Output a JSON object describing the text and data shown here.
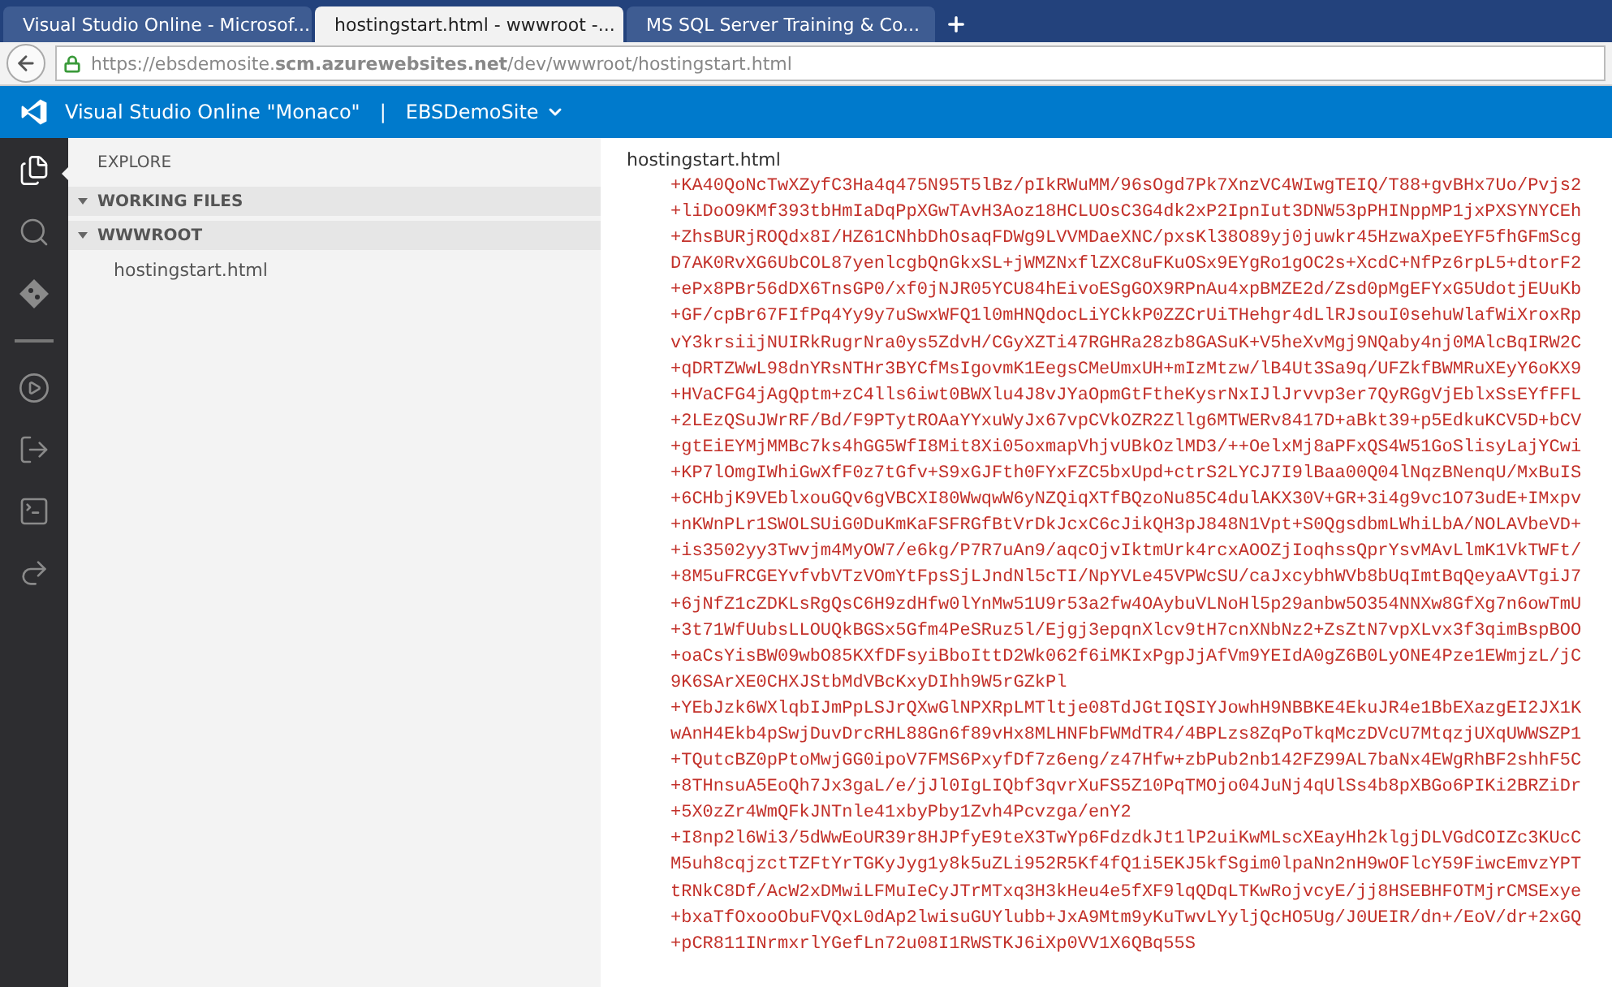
{
  "browser_tabs": [
    {
      "title": "Visual Studio Online - Microsof...",
      "selected": false
    },
    {
      "title": "hostingstart.html - wwwroot -...",
      "selected": true
    },
    {
      "title": "MS SQL Server Training & Co...",
      "selected": false
    }
  ],
  "address_bar": {
    "url": "https://ebsdemosite.**scm.azurewebsites.net**/dev/wwwroot/hostingstart.html"
  },
  "app_header": {
    "title": "Visual Studio Online \"Monaco\"",
    "separator": "|",
    "site": "EBSDemoSite"
  },
  "activity_bar": [
    {
      "selected": true
    },
    {
      "selected": false
    },
    {
      "selected": false
    },
    {
      "selected": false
    },
    {
      "selected": false
    },
    {
      "selected": false
    },
    {
      "selected": false
    }
  ],
  "sidebar": {
    "title": "EXPLORE",
    "sections": [
      {
        "label": "WORKING FILES",
        "expanded": true
      },
      {
        "label": "WWWROOT",
        "expanded": true,
        "children": [
          {
            "label": "hostingstart.html"
          }
        ]
      }
    ]
  },
  "editor": {
    "file_name": "hostingstart.html",
    "lines": [
      "+KA40QoNcTwXZyfC3Ha4q475N95T5lBz/pIkRWuMM/96sOgd7Pk7XnzVC4WIwgTEIQ/T88+gvBHx7Uo/Pvjs2",
      "+liDoO9KMf393tbHmIaDqPpXGwTAvH3Aoz18HCLUOsC3G4dk2xP2IpnIut3DNW53pPHINppMP1jxPXSYNYCEh",
      "+ZhsBURjROQdx8I/HZ61CNhbDhOsaqFDWg9LVVMDaeXNC/pxsKl38O89yj0juwkr45HzwaXpeEYF5fhGFmScg",
      "D7AK0RvXG6UbCOL87yenlcgbQnGkxSL+jWMZNxflZXC8uFKuOSx9EYgRo1gOC2s+XcdC+NfPz6rpL5+dtorF2",
      "+ePx8PBr56dDX6TnsGP0/xf0jNJR05YCU84hEivoESgGOX9RPnAu4xpBMZE2d/Zsd0pMgEFYxG5UdotjEUuKb",
      "+GF/cpBr67FIfPq4Yy9y7uSwxWFQ1l0mHNQdocLiYCkkP0ZZCrUiTHehgr4dLlRJsouI0sehuWlafWiXroxRp",
      "vY3krsiijNUIRkRugrNra0ys5ZdvH/CGyXZTi47RGHRa28zb8GASuK+V5heXvMgj9NQaby4nj0MAlcBqIRW2C",
      "+qDRTZWwL98dnYRsNTHr3BYCfMsIgovmK1EegsCMeUmxUH+mIzMtzw/lB4Ut3Sa9q/UFZkfBWMRuXEyY6oKX9",
      "+HVaCFG4jAgQptm+zC4lls6iwt0BWXlu4J8vJYaOpmGtFtheKysrNxIJlJrvvp3er7QyRGgVjEblxSsEYfFFL",
      "+2LEzQSuJWrRF/Bd/F9PTytROAaYYxuWyJx67vpCVkOZR2Zllg6MTWERv8417D+aBkt39+p5EdkuKCV5D+bCV",
      "+gtEiEYMjMMBc7ks4hGG5WfI8Mit8Xi05oxmapVhjvUBkOzlMD3/++OelxMj8aPFxQS4W51GoSlisyLajYCwi",
      "+KP7lOmgIWhiGwXfF0z7tGfv+S9xGJFth0FYxFZC5bxUpd+ctrS2LYCJ7I9lBaa00Q04lNqzBNenqU/MxBuIS",
      "+6CHbjK9VEblxouGQv6gVBCXI80WwqwW6yNZQiqXTfBQzoNu85C4dulAKX30V+GR+3i4g9vc1O73udE+IMxpv",
      "+nKWnPLr1SWOLSUiG0DuKmKaFSFRGfBtVrDkJcxC6cJikQH3pJ848N1Vpt+S0QgsdbmLWhiLbA/NOLAVbeVD+",
      "+is3502yy3Twvjm4MyOW7/e6kg/P7R7uAn9/aqcOjvIktmUrk4rcxAOOZjIoqhssQprYsvMAvLlmK1VkTWFt/",
      "+8M5uFRCGEYvfvbVTzVOmYtFpsSjLJndNl5cTI/NpYVLe45VPWcSU/caJxcybhWVb8bUqImtBqQeyaAVTgiJ7",
      "+6jNfZ1cZDKLsRgQsC6H9zdHfw0lYnMw51U9r53a2fw4OAybuVLNoHl5p29anbw5O354NNXw8GfXg7n6owTmU",
      "+3t71WfUubsLLOUQkBGSx5Gfm4PeSRuz5l/Ejgj3epqnXlcv9tH7cnXNbNz2+ZsZtN7vpXLvx3f3qimBspBOO",
      "+oaCsYisBW09wbO85KXfDFsyiBboIttD2Wk062f6iMKIxPgpJjAfVm9YEIdA0gZ6B0LyONE4Pze1EWmjzL/jC",
      "9K6SArXE0CHXJStbMdVBcKxyDIhh9W5rGZkPl",
      "+YEbJzk6WXlqbIJmPpLSJrQXwGlNPXRpLMTltje08TdJGtIQSIYJowhH9NBBKE4EkuJR4e1BbEXazgEI2JX1K",
      "wAnH4Ekb4pSwjDuvDrcRHL88Gn6f89vHx8MLHNFbFWMdTR4/4BPLzs8ZqPoTkqMczDVcU7MtqzjUXqUWWSZP1",
      "+TQutcBZ0pPtoMwjGG0ipoV7FMS6PxyfDf7z6eng/z47Hfw+zbPub2nb142FZ99AL7baNx4EWgRhBF2shhF5C",
      "+8THnsuA5EoQh7Jx3gaL/e/jJl0IgLIQbf3qvrXuFS5Z10PqTMOjo04JuNj4qUlSs4b8pXBGo6PIKi2BRZiDr",
      "+5X0zZr4WmQFkJNTnle41xbyPby1Zvh4Pcvzga/enY2",
      "+I8np2l6Wi3/5dWwEoUR39r8HJPfyE9teX3TwYp6FdzdkJt1lP2uiKwMLscXEayHh2klgjDLVGdCOIZc3KUcC",
      "M5uh8cqjzctTZFtYrTGKyJyg1y8k5uZLi952R5Kf4fQ1i5EKJ5kfSgim0lpaNn2nH9wOFlcY59FiwcEmvzYPT",
      "tRNkC8Df/AcW2xDMwiLFMuIeCyJTrMTxq3H3kHeu4e5fXF9lqQDqLTKwRojvcyE/jj8HSEBHFOTMjrCMSExye",
      "+bxaTfOxooObuFVQxL0dAp2lwisuGUYlubb+JxA9Mtm9yKuTwvLYyljQcHO5Ug/J0UEIR/dn+/EoV/dr+2xGQ",
      "+pCR811INrmxrlYGefLn72u08I1RWSTKJ6iXp0VV1X6QBq55S"
    ]
  }
}
